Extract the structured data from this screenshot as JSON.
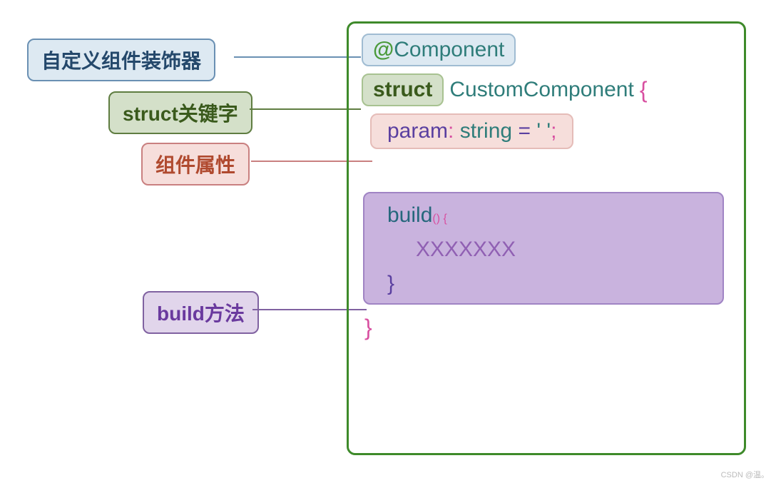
{
  "labels": {
    "decorator": "自定义组件装饰器",
    "struct_kw": "struct关键字",
    "prop": "组件属性",
    "build": "build方法"
  },
  "code": {
    "at": "@",
    "component": "Component",
    "struct": "struct",
    "className": "CustomComponent",
    "openBrace": "{",
    "param_name": "param",
    "colon": ":",
    "type": "string",
    "eq": "=",
    "strval": "' '",
    "semi": ";",
    "build_name": "build",
    "parens": "()",
    "build_open": "{",
    "xxxx": "XXXXXXX",
    "build_close": "}",
    "closeBrace": "}"
  },
  "watermark": "CSDN @温。"
}
